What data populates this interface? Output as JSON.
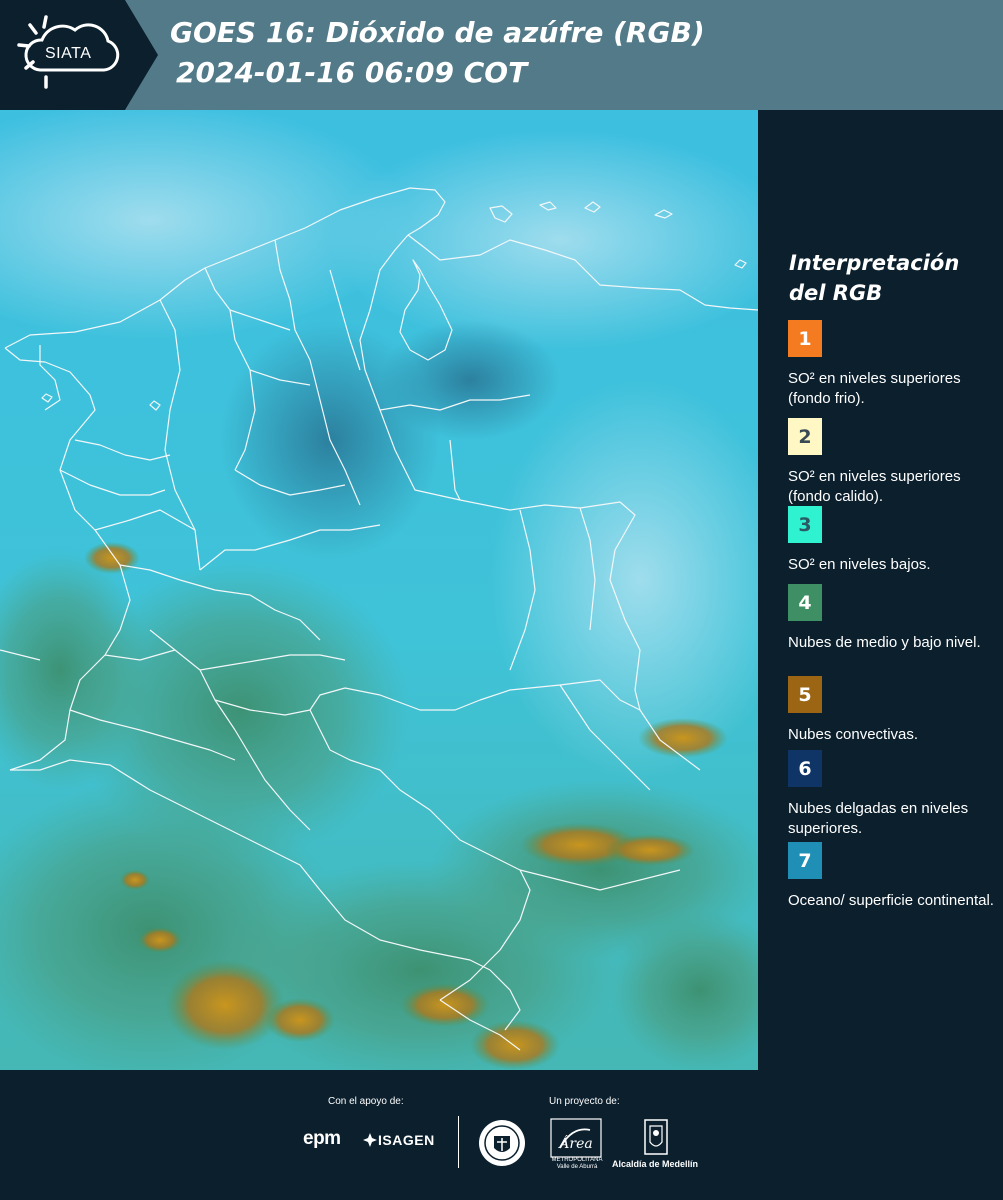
{
  "header": {
    "logo_text": "SIATA",
    "title_line1": "GOES 16: Dióxido de azúfre (RGB)",
    "title_line2": "2024-01-16 06:09 COT",
    "background_color": "#527a89",
    "logo_panel_color": "#0b1f2d"
  },
  "legend": {
    "title_line1": "Interpretación",
    "title_line2": "del RGB",
    "items": [
      {
        "number": "1",
        "color": "#f47b20",
        "number_color": "#ffffff",
        "label": "SO² en niveles superiores (fondo frio)."
      },
      {
        "number": "2",
        "color": "#fff8c4",
        "number_color": "#3a4a55",
        "label": "SO² en niveles superiores (fondo calido)."
      },
      {
        "number": "3",
        "color": "#2ff2d0",
        "number_color": "#2c5a63",
        "label": "SO² en niveles bajos."
      },
      {
        "number": "4",
        "color": "#3e8f63",
        "number_color": "#ffffff",
        "label": "Nubes de medio y bajo nivel."
      },
      {
        "number": "5",
        "color": "#9c6514",
        "number_color": "#ffffff",
        "label": "Nubes convectivas."
      },
      {
        "number": "6",
        "color": "#0f3566",
        "number_color": "#ffffff",
        "label": "Nubes delgadas en niveles superiores."
      },
      {
        "number": "7",
        "color": "#1f8fb5",
        "number_color": "#ffffff",
        "label": "Oceano/ superficie continental."
      }
    ]
  },
  "footer": {
    "support_label": "Con el apoyo de:",
    "project_label": "Un proyecto de:",
    "sponsor_epm": "epm",
    "sponsor_isagen": "ISAGEN",
    "area_name": "Área",
    "area_sub1": "METROPOLITANA",
    "area_sub2": "Valle de Aburrá",
    "alcaldia": "Alcaldía de Medellín"
  }
}
